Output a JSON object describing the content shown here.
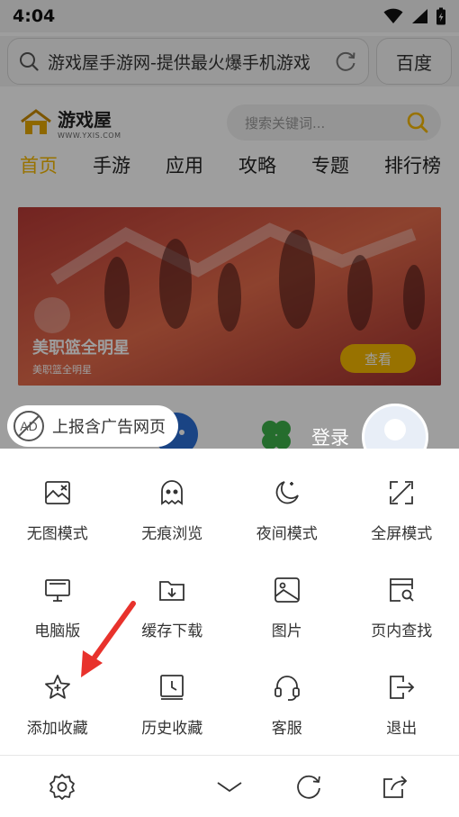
{
  "status_bar": {
    "time": "4:04"
  },
  "browser": {
    "address_text": "游戏屋手游网-提供最火爆手机游戏",
    "search_engine_label": "百度"
  },
  "site": {
    "logo_title": "游戏屋",
    "logo_url": "WWW.YXIS.COM",
    "search_placeholder": "搜索关键词...",
    "nav": [
      "首页",
      "手游",
      "应用",
      "攻略",
      "专题",
      "排行榜"
    ],
    "banner": {
      "title": "美职篮全明星",
      "subtitle": "美职篮全明星",
      "button": "查看"
    }
  },
  "overlay": {
    "ad_report_label": "上报含广告网页",
    "login_label": "登录"
  },
  "menu": {
    "items": [
      {
        "label": "无图模式",
        "icon": "no-image-icon"
      },
      {
        "label": "无痕浏览",
        "icon": "ghost-icon"
      },
      {
        "label": "夜间模式",
        "icon": "moon-icon"
      },
      {
        "label": "全屏模式",
        "icon": "fullscreen-icon"
      },
      {
        "label": "电脑版",
        "icon": "desktop-icon"
      },
      {
        "label": "缓存下载",
        "icon": "download-folder-icon"
      },
      {
        "label": "图片",
        "icon": "picture-icon"
      },
      {
        "label": "页内查找",
        "icon": "find-in-page-icon"
      },
      {
        "label": "添加收藏",
        "icon": "star-add-icon"
      },
      {
        "label": "历史收藏",
        "icon": "history-icon"
      },
      {
        "label": "客服",
        "icon": "headset-icon"
      },
      {
        "label": "退出",
        "icon": "exit-icon"
      }
    ]
  },
  "colors": {
    "accent": "#f5b800",
    "arrow": "#e8322c"
  }
}
